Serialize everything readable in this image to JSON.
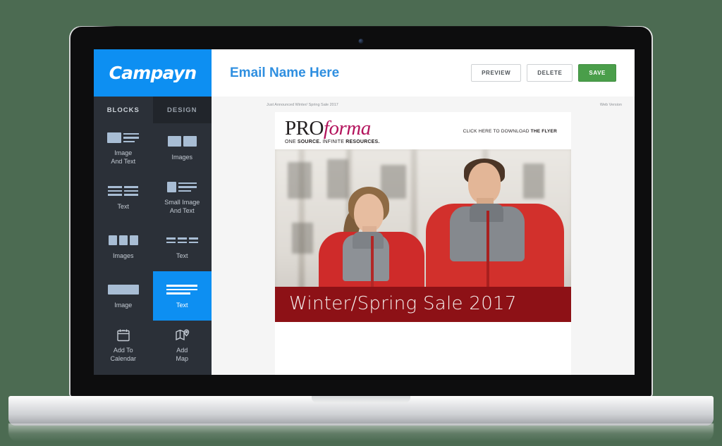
{
  "app": {
    "brand": "Campayn",
    "brand_color": "#0d8ff2",
    "background_color": "#4c6b52"
  },
  "sidebar": {
    "tabs": [
      {
        "label": "BLOCKS",
        "active": true
      },
      {
        "label": "DESIGN",
        "active": false
      }
    ],
    "blocks": [
      {
        "label": "Image\nAnd Text",
        "icon": "image-and-text-icon",
        "selected": false
      },
      {
        "label": "Images",
        "icon": "two-images-icon",
        "selected": false
      },
      {
        "label": "Text",
        "icon": "two-column-text-icon",
        "selected": false
      },
      {
        "label": "Small Image\nAnd Text",
        "icon": "small-image-and-text-icon",
        "selected": false
      },
      {
        "label": "Images",
        "icon": "three-images-icon",
        "selected": false
      },
      {
        "label": "Text",
        "icon": "three-column-text-icon",
        "selected": false
      },
      {
        "label": "Image",
        "icon": "full-image-icon",
        "selected": false
      },
      {
        "label": "Text",
        "icon": "full-text-icon",
        "selected": true
      },
      {
        "label": "Add To\nCalendar",
        "icon": "calendar-icon",
        "selected": false
      },
      {
        "label": "Add\nMap",
        "icon": "map-pin-icon",
        "selected": false
      }
    ]
  },
  "topbar": {
    "email_title": "Email Name Here",
    "buttons": [
      {
        "label": "PREVIEW",
        "style": "secondary"
      },
      {
        "label": "DELETE",
        "style": "secondary"
      },
      {
        "label": "SAVE",
        "style": "primary",
        "color": "#4a9e4a"
      }
    ]
  },
  "email": {
    "preheader_left": "Just Announced Winter/ Spring Sale 2017",
    "preheader_right": "Web Version",
    "logo": {
      "part_one": "PRO",
      "part_two": "forma",
      "part_one_color": "#231f20",
      "part_two_color": "#b3135c",
      "tagline_plain_one": "ONE ",
      "tagline_bold_one": "SOURCE.",
      "tagline_plain_two": " INFINITE ",
      "tagline_bold_two": "RESOURCES."
    },
    "flyer_cta_plain": "CLICK HERE TO DOWNLOAD ",
    "flyer_cta_bold": "THE FLYER",
    "hero_alt": "Two models wearing red and grey soft-shell jackets on a city street",
    "banner_text": "Winter/Spring Sale 2017",
    "banner_color": "#8d1116"
  }
}
